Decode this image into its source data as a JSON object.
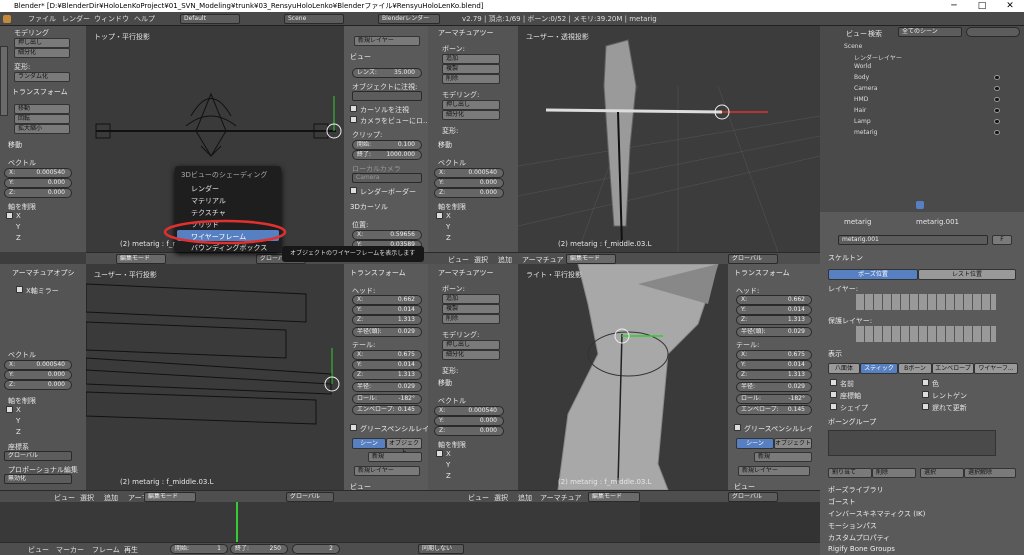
{
  "window": {
    "title": "Blender* [D:¥BlenderDir¥HoloLenKoProject¥01_SVN_Modeling¥trunk¥03_RensyuHoloLenko¥Blenderファイル¥RensyuHoloLenKo.blend]",
    "minimize": "─",
    "maximize": "□",
    "close": "✕"
  },
  "topbar": {
    "menus": [
      "ファイル",
      "レンダー",
      "ウィンドウ",
      "ヘルプ"
    ],
    "layout": "Default",
    "scene": "Scene",
    "engine": "Blenderレンダー",
    "stats": "v2.79 | 頂点:1/69 | ボーン:0/52 | メモリ:39.20M | metarig"
  },
  "toolshelf_tl": {
    "items": [
      "モデリング",
      "押し出し",
      "細分化",
      "変形:",
      "ランダム化",
      "トランスフォーム",
      "移動",
      "回転",
      "拡大縮小"
    ]
  },
  "panel_tl": {
    "title": "移動",
    "vector": "ベクトル",
    "x": "X:",
    "xv": "0.000540",
    "y": "Y:",
    "yv": "0.000",
    "z": "Z:",
    "zv": "0.000",
    "constraint": "軸を制限",
    "cx": "X",
    "cy": "Y",
    "cz": "Z"
  },
  "vp_tl": {
    "label": "トップ・平行投影",
    "status": "(2) metarig : f_middle.03.L"
  },
  "popup": {
    "title": "3Dビューのシェーディング",
    "items": [
      "レンダー",
      "マテリアル",
      "テクスチャ",
      "ソリッド",
      "ワイヤーフレーム",
      "バウンディングボックス"
    ]
  },
  "tooltip": "オブジェクトのワイヤーフレームを表示します",
  "npanel_top": {
    "new_layer": "新規レイヤー",
    "view": "ビュー",
    "lens_label": "レンズ:",
    "lens": "35.000",
    "lock_obj": "オブジェクトに注視:",
    "lock_cursor": "カーソルを注視",
    "cam_to_view": "カメラをビューにロ...",
    "clip": "クリップ:",
    "clip_start_l": "開始:",
    "clip_start": "0.100",
    "clip_end_l": "終了:",
    "clip_end": "1000.000",
    "local_cam": "ローカルカメラ",
    "camera": "Camera",
    "render_border": "レンダーボーダー",
    "cursor": "3Dカーソル",
    "location": "位置:",
    "cx": "X:",
    "cxv": "0.59656",
    "cy": "Y:",
    "cyv": "0.03589"
  },
  "armature_tools": {
    "title": "アーマチュアツー",
    "bone": "ボーン:",
    "add": "追加",
    "dup": "複製",
    "del": "削除",
    "modeling": "モデリング:",
    "extrude": "押し出し",
    "subdiv": "細分化",
    "transform": "変形:"
  },
  "vp_tr": {
    "label": "ユーザー・透視投影",
    "status": "(2) metarig : f_middle.03.L"
  },
  "header_mid": {
    "menus": [
      "ビュー",
      "選択",
      "追加",
      "アーマチュア"
    ],
    "mode": "編集モード",
    "pivot": "グローバル"
  },
  "toolshelf_bl": {
    "title": "アーマチュアオプシ",
    "xmirror": "X軸ミラー"
  },
  "panel_bl": {
    "vector": "ベクトル",
    "xv": "0.000540",
    "yv": "0.000",
    "zv": "0.000",
    "constraint": "軸を制限",
    "coord": "座標系",
    "global": "グローバル",
    "prop_edit": "プロポーショナル編集",
    "disabled": "無効化"
  },
  "vp_bl": {
    "label": "ユーザー・平行投影",
    "status": "(2) metarig : f_middle.03.L"
  },
  "trans_b": {
    "title": "トランスフォーム",
    "head": "ヘッド:",
    "hx": "0.662",
    "hy": "0.014",
    "hz": "1.313",
    "hr_l": "半径(頭):",
    "hr": "0.029",
    "tail": "テール:",
    "tx": "0.675",
    "ty": "0.014",
    "tz": "1.313",
    "tr_l": "半径:",
    "tr": "0.029",
    "roll_l": "ロール:",
    "roll": "-182°",
    "env_l": "エンベロープ:",
    "env": "0.145",
    "gp": "グリースペンシルレイ",
    "scene": "シーン",
    "object": "オブジェクト",
    "new": "新規",
    "new_layer": "新規レイヤー",
    "view": "ビュー"
  },
  "vp_br": {
    "label": "ライト・平行投影",
    "status": "(2) metarig : f_middle.03.L"
  },
  "panel_br": {
    "title": "移動",
    "vector": "ベクトル",
    "xv": "0.000540",
    "yv": "0.000",
    "zv": "0.000",
    "constraint": "軸を制限"
  },
  "header_bottom": {
    "menus": [
      "ビュー",
      "選択",
      "追加",
      "アーマチュア"
    ],
    "mode": "編集モード",
    "pivot": "グローバル"
  },
  "timeline": {
    "menus": [
      "ビュー",
      "マーカー",
      "フレーム",
      "再生"
    ],
    "start_l": "開始:",
    "start": "1",
    "end_l": "終了:",
    "end": "250",
    "frame": "2",
    "sync": "同期しない"
  },
  "outliner": {
    "menus": [
      "ビュー",
      "検索"
    ],
    "filter": "全てのシーン",
    "items": [
      "Scene",
      "レンダーレイヤー",
      "World",
      "Body",
      "Camera",
      "HMD",
      "Hair",
      "Lamp",
      "metarig"
    ]
  },
  "props": {
    "breadcrumb1": "metarig",
    "breadcrumb2": "metarig.001",
    "name": "metarig.001",
    "f": "F",
    "skeleton": "スケルトン",
    "pose_pos": "ポーズ位置",
    "rest_pos": "レスト位置",
    "layers": "レイヤー:",
    "protect": "保護レイヤー:",
    "display": "表示",
    "d_types": [
      "八面体",
      "スティック",
      "Bボーン",
      "エンベロープ",
      "ワイヤーフ..."
    ],
    "names": "名前",
    "axes": "座標軸",
    "shape": "シェイプ",
    "colors": "色",
    "xray": "レントゲン",
    "delay": "遅れて更新",
    "bone_groups": "ボーングループ",
    "assign": "割り当て",
    "remove": "削除",
    "select": "選択",
    "deselect": "選択解除",
    "panels": [
      "ポーズライブラリ",
      "ゴースト",
      "インバースキネマティクス (IK)",
      "モーションパス",
      "カスタムプロパティ",
      "Rigify Bone Groups"
    ]
  },
  "colors": {
    "accent": "#5680c2",
    "popup_sel": "#5680c2",
    "highlight": "#e03030"
  }
}
